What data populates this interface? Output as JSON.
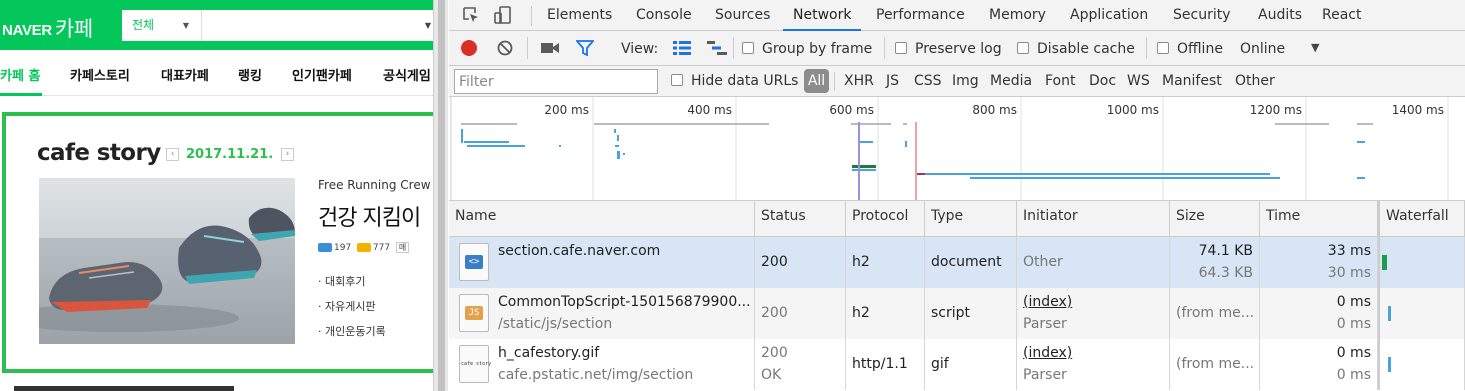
{
  "naver": {
    "logo": "NAVER",
    "logo_cafe": "카페",
    "search_select": "전체",
    "nav": [
      "카페 홈",
      "카페스토리",
      "대표카페",
      "랭킹",
      "인기팬카페",
      "공식게임"
    ],
    "story": {
      "title": "cafe story",
      "date": "2017.11.21.",
      "club": "Free Running Crew",
      "headline": "건강 지킴이",
      "members": "197",
      "comments": "777",
      "more": "매",
      "links": [
        "· 대회후기",
        "· 자유게시판",
        "· 개인운동기록"
      ]
    }
  },
  "devtools": {
    "tabs": [
      "Elements",
      "Console",
      "Sources",
      "Network",
      "Performance",
      "Memory",
      "Application",
      "Security",
      "Audits",
      "React"
    ],
    "active_tab": "Network",
    "toolbar": {
      "view_label": "View:",
      "group_by_frame": "Group by frame",
      "preserve_log": "Preserve log",
      "disable_cache": "Disable cache",
      "offline": "Offline",
      "throttle": "Online"
    },
    "filter": {
      "placeholder": "Filter",
      "hide_data_urls": "Hide data URLs",
      "all": "All",
      "types": [
        "XHR",
        "JS",
        "CSS",
        "Img",
        "Media",
        "Font",
        "Doc",
        "WS",
        "Manifest",
        "Other"
      ]
    },
    "overview_ticks": [
      "200 ms",
      "400 ms",
      "600 ms",
      "800 ms",
      "1000 ms",
      "1200 ms",
      "1400 ms"
    ],
    "columns": [
      "Name",
      "Status",
      "Protocol",
      "Type",
      "Initiator",
      "Size",
      "Time",
      "Waterfall"
    ],
    "rows": [
      {
        "icon": "<>",
        "name": "section.cafe.naver.com",
        "path": "",
        "status": "200",
        "status2": "",
        "protocol": "h2",
        "type": "document",
        "initiator": "Other",
        "initiator2": "",
        "size": "74.1 KB",
        "size2": "64.3 KB",
        "time": "33 ms",
        "time2": "30 ms"
      },
      {
        "icon": "JS",
        "name": "CommonTopScript-150156879900...",
        "path": "/static/js/section",
        "status": "200",
        "status2": "",
        "protocol": "h2",
        "type": "script",
        "initiator": "(index)",
        "initiator2": "Parser",
        "size": "(from me...",
        "size2": "",
        "time": "0 ms",
        "time2": "0 ms"
      },
      {
        "icon": "cafe story",
        "name": "h_cafestory.gif",
        "path": "cafe.pstatic.net/img/section",
        "status": "200",
        "status2": "OK",
        "protocol": "http/1.1",
        "type": "gif",
        "initiator": "(index)",
        "initiator2": "Parser",
        "size": "(from me...",
        "size2": "",
        "time": "0 ms",
        "time2": "0 ms"
      }
    ],
    "colors": {
      "accent": "#1a73e8",
      "record": "#d93025",
      "selected_row": "#d7e5f5",
      "naver_green": "#03c75a"
    }
  }
}
